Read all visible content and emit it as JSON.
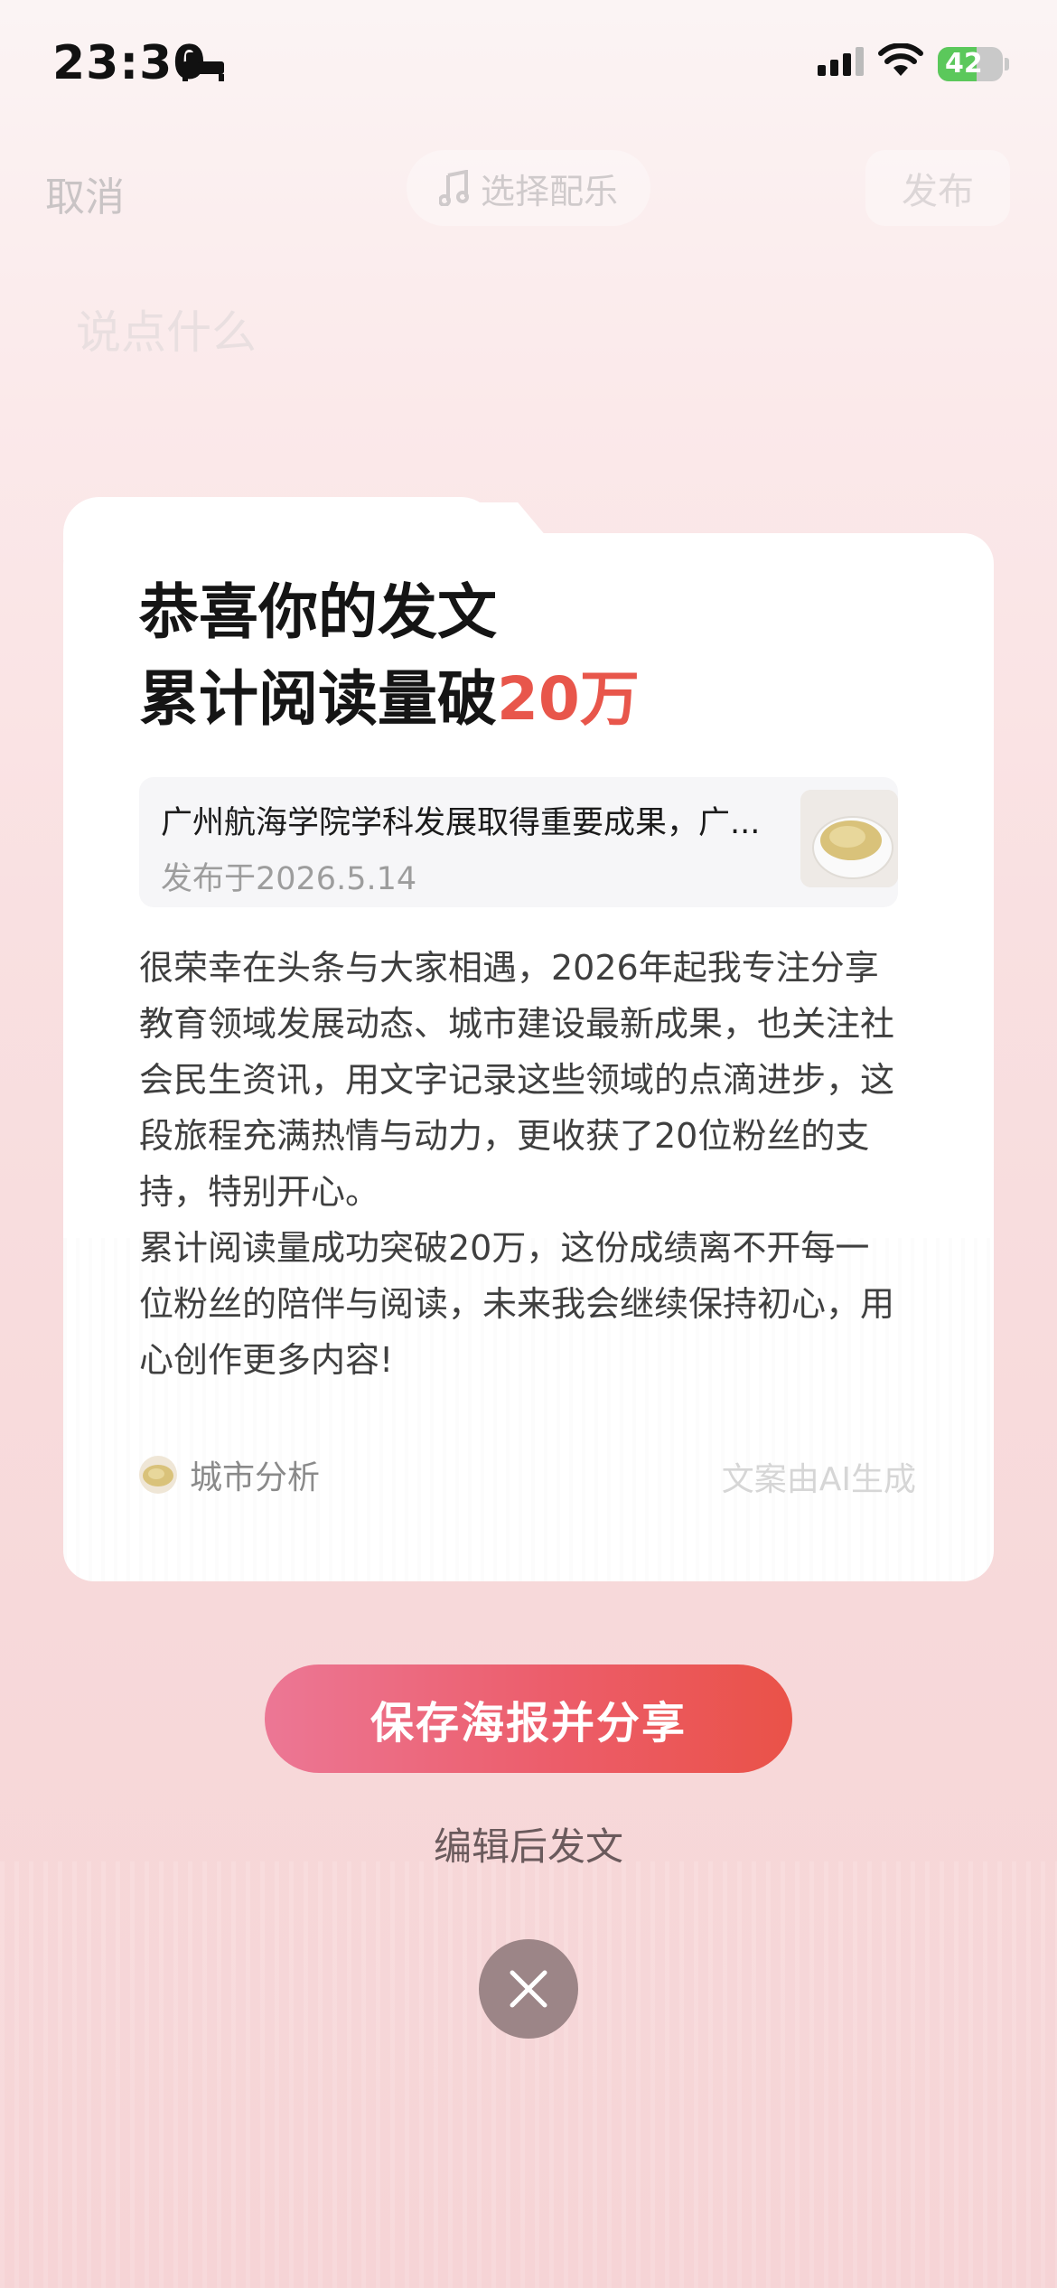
{
  "status_bar": {
    "time": "23:30",
    "battery": "42"
  },
  "topbar": {
    "cancel": "取消",
    "music": "选择配乐",
    "publish": "发布"
  },
  "compose": {
    "placeholder": "说点什么"
  },
  "card": {
    "title_line1": "恭喜你的发文",
    "title_line2_prefix": "累计阅读量破",
    "title_line2_highlight": "20万",
    "article_title": "广州航海学院学科发展取得重要成果，广...",
    "article_date": "发布于2026.5.14",
    "body_para1": "很荣幸在头条与大家相遇，2026年起我专注分享教育领域发展动态、城市建设最新成果，也关注社会民生资讯，用文字记录这些领域的点滴进步，这段旅程充满热情与动力，更收获了20位粉丝的支持，特别开心。",
    "body_para2": "累计阅读量成功突破20万，这份成绩离不开每一位粉丝的陪伴与阅读，未来我会继续保持初心，用心创作更多内容!",
    "author": "城市分析",
    "ai_note": "文案由AI生成"
  },
  "actions": {
    "share": "保存海报并分享",
    "edit": "编辑后发文"
  },
  "colors": {
    "highlight": "#e8564b",
    "share_start": "#ec7795",
    "share_end": "#ea5248"
  }
}
